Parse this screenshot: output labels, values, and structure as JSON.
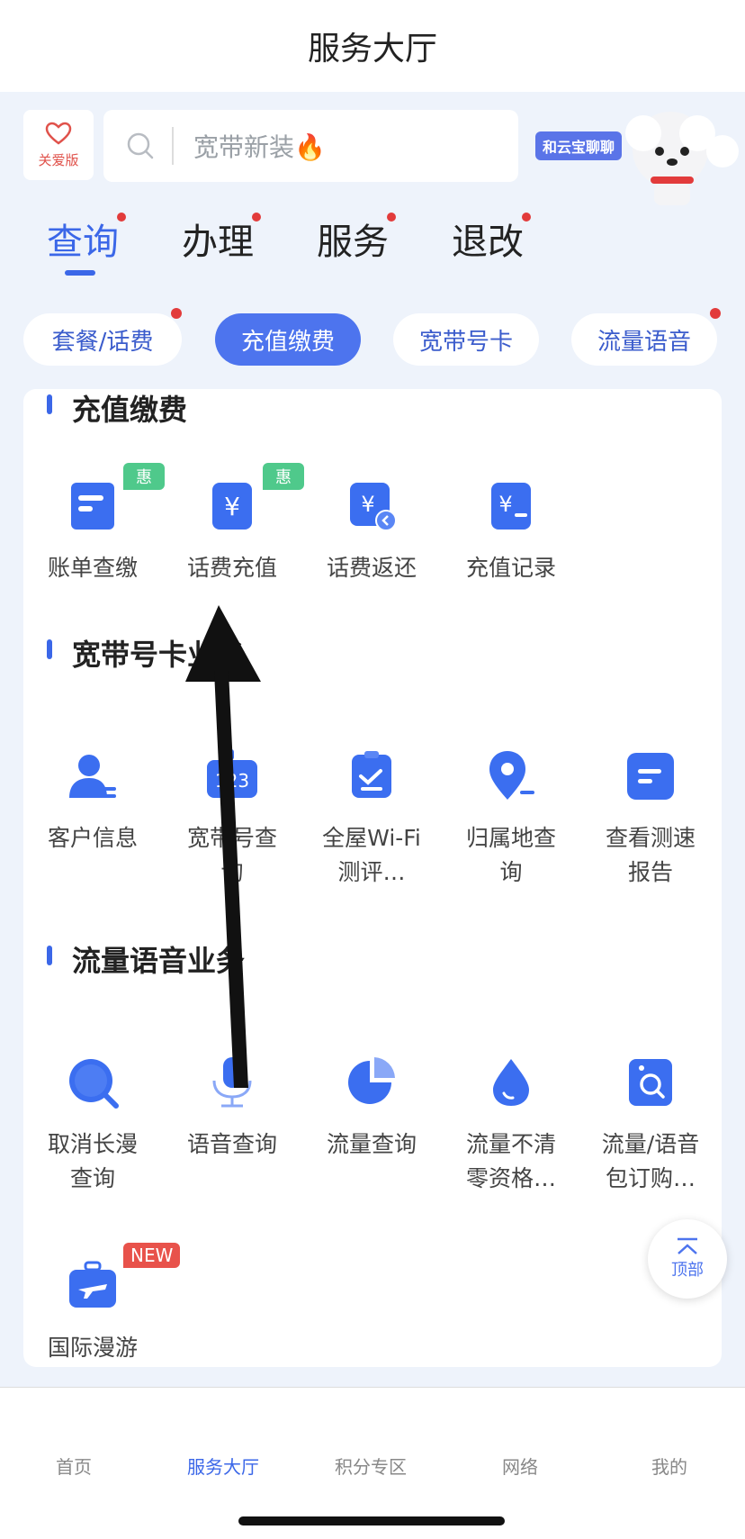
{
  "header": {
    "title": "服务大厅"
  },
  "care": {
    "label": "关爱版"
  },
  "search": {
    "placeholder": "宽带新装🔥"
  },
  "bot": {
    "tag": "和云宝聊聊"
  },
  "categories": [
    {
      "label": "查询"
    },
    {
      "label": "办理"
    },
    {
      "label": "服务"
    },
    {
      "label": "退改"
    }
  ],
  "chips": [
    {
      "label": "套餐/话费"
    },
    {
      "label": "充值缴费"
    },
    {
      "label": "宽带号卡"
    },
    {
      "label": "流量语音"
    }
  ],
  "sections": [
    {
      "title": "充值缴费",
      "items": [
        {
          "label": "账单查缴",
          "badge": "惠",
          "icon": "bill-icon"
        },
        {
          "label": "话费充值",
          "badge": "惠",
          "icon": "yuan-recharge-icon"
        },
        {
          "label": "话费返还",
          "icon": "yuan-refund-icon"
        },
        {
          "label": "充值记录",
          "icon": "yuan-record-icon"
        }
      ]
    },
    {
      "title": "宽带号卡业务",
      "items": [
        {
          "label": "客户信息",
          "icon": "user-icon"
        },
        {
          "label": "宽带号查询",
          "icon": "number-card-icon"
        },
        {
          "label": "全屋Wi-Fi测评…",
          "icon": "wifi-check-icon"
        },
        {
          "label": "归属地查询",
          "icon": "location-icon"
        },
        {
          "label": "查看测速报告",
          "icon": "report-icon"
        }
      ]
    },
    {
      "title": "流量语音业务",
      "items": [
        {
          "label": "取消长漫查询",
          "icon": "search-bubble-icon"
        },
        {
          "label": "语音查询",
          "icon": "microphone-icon"
        },
        {
          "label": "流量查询",
          "icon": "pie-chart-icon"
        },
        {
          "label": "流量不清零资格…",
          "icon": "water-drop-icon"
        },
        {
          "label": "流量/语音包订购…",
          "icon": "package-search-icon"
        },
        {
          "label": "国际漫游",
          "badge": "NEW",
          "icon": "luggage-plane-icon"
        }
      ]
    }
  ],
  "top_button": {
    "label": "顶部"
  },
  "tabbar": [
    {
      "label": "首页"
    },
    {
      "label": "服务大厅"
    },
    {
      "label": "积分专区"
    },
    {
      "label": "网络"
    },
    {
      "label": "我的"
    }
  ],
  "colors": {
    "accent": "#3b67e8",
    "badge_green": "#4fc98b",
    "badge_red": "#e8524b"
  }
}
